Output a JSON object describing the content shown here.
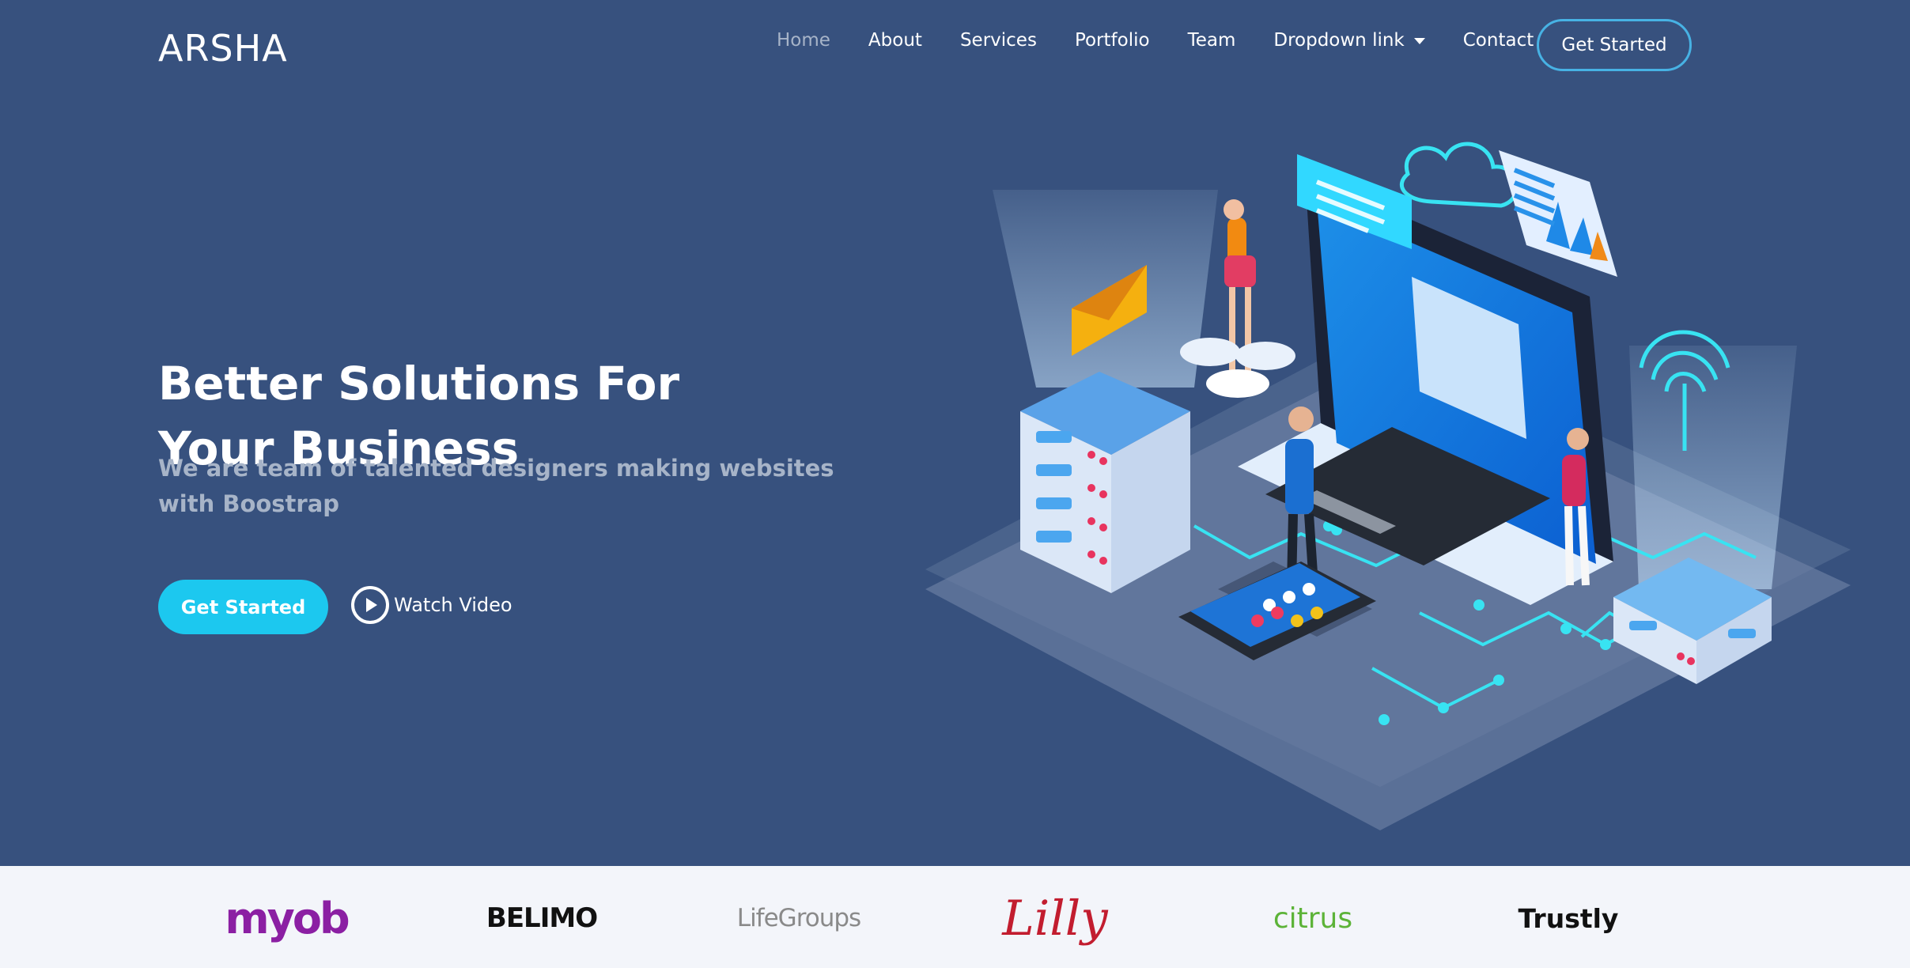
{
  "brand": "ARSHA",
  "nav": {
    "items": [
      "Home",
      "About",
      "Services",
      "Portfolio",
      "Team",
      "Dropdown link",
      "Contact"
    ],
    "cta": "Get Started"
  },
  "hero": {
    "title": "Better Solutions For Your Business",
    "subtitle": "We are team of talented designers making websites with Boostrap",
    "primary_button": "Get Started",
    "video_button": "Watch Video"
  },
  "clients": {
    "logos": [
      "myob",
      "BELIMO",
      "LifeGroups",
      "Lilly",
      "citrus",
      "Trustly"
    ]
  },
  "colors": {
    "hero_bg": "#37517e",
    "accent": "#47b2e4",
    "button": "#1cc8ef",
    "clients_bg": "#f3f5fa",
    "muted_text": "#a7b4c8"
  },
  "icons": [
    "play-icon",
    "caret-down-icon",
    "lilly-logo",
    "trustly-lock-icon"
  ]
}
